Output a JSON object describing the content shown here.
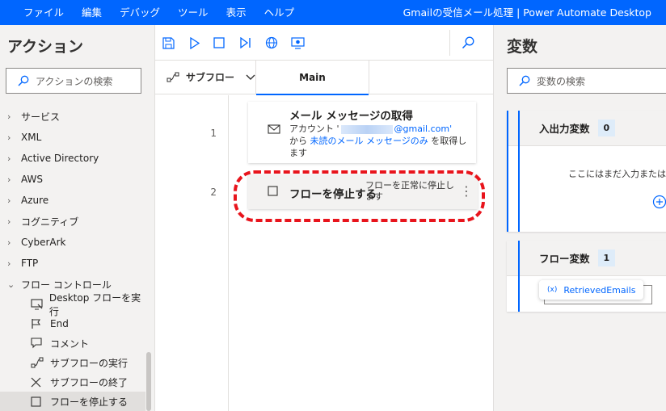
{
  "menu": [
    "ファイル",
    "編集",
    "デバッグ",
    "ツール",
    "表示",
    "ヘルプ"
  ],
  "window_title": "Gmailの受信メール処理 | Power Automate Desktop",
  "actions_pane": {
    "title": "アクション",
    "search_placeholder": "アクションの検索",
    "categories": [
      "サービス",
      "XML",
      "Active Directory",
      "AWS",
      "Azure",
      "コグニティブ",
      "CyberArk",
      "FTP",
      "フロー コントロール"
    ],
    "flow_control_items": [
      "Desktop フローを実行",
      "End",
      "コメント",
      "サブフローの実行",
      "サブフローの終了",
      "フローを停止する"
    ]
  },
  "designer": {
    "subflow_label": "サブフロー",
    "main_tab": "Main",
    "steps": [
      {
        "line": "1",
        "name": "メール メッセージの取得",
        "account_prefix": "アカウント '",
        "account_suffix": "@gmail.com'",
        "from_prefix": "から",
        "from_link": "未読のメール メッセージのみ",
        "from_suffix": "を取得し",
        "tail": "ます"
      },
      {
        "line": "2",
        "name": "フローを停止する",
        "desc": "フローを正常に停止します"
      }
    ]
  },
  "variables_pane": {
    "title": "変数",
    "search_placeholder": "変数の検索",
    "io_section": {
      "title": "入出力変数",
      "count": "0",
      "empty_message": "ここにはまだ入力または出"
    },
    "flow_section": {
      "title": "フロー変数",
      "count": "1",
      "variables": [
        "RetrievedEmails"
      ]
    },
    "variable_chip_icon": "(x)"
  },
  "accent_color": "#0066ff",
  "highlight_color": "#e8141c"
}
